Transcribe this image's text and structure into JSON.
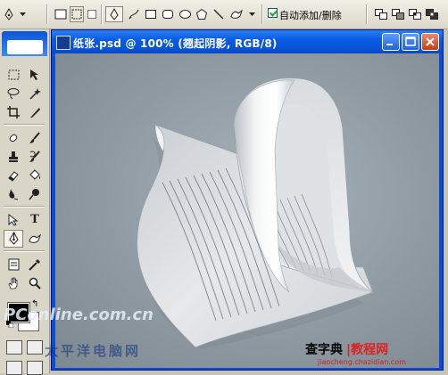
{
  "options_bar": {
    "auto_add_delete_label": "自动添加/删除",
    "auto_add_delete_checked": true
  },
  "tools": {
    "icons": [
      "marquee-tool-icon",
      "move-tool-icon",
      "lasso-tool-icon",
      "magic-wand-tool-icon",
      "crop-tool-icon",
      "slice-tool-icon",
      "healing-brush-tool-icon",
      "brush-tool-icon",
      "clone-stamp-tool-icon",
      "history-brush-tool-icon",
      "eraser-tool-icon",
      "paint-bucket-tool-icon",
      "blur-tool-icon",
      "dodge-tool-icon",
      "path-selection-tool-icon",
      "type-tool-icon",
      "pen-tool-icon",
      "custom-shape-tool-icon",
      "notes-tool-icon",
      "eyedropper-tool-icon",
      "hand-tool-icon",
      "zoom-tool-icon"
    ],
    "selected": "pen-tool-icon",
    "foreground_color": "#000000",
    "background_color": "#ffffff"
  },
  "document": {
    "title": "纸张.psd @ 100% (翘起阴影, RGB/8)"
  },
  "watermarks": {
    "pconline": "PConline.com.cn",
    "pacific": "太平洋电脑网",
    "chazidian_a": "查字典",
    "chazidian_b": "教程网",
    "chazidian_url": "jiaocheng.chazidian.com"
  }
}
